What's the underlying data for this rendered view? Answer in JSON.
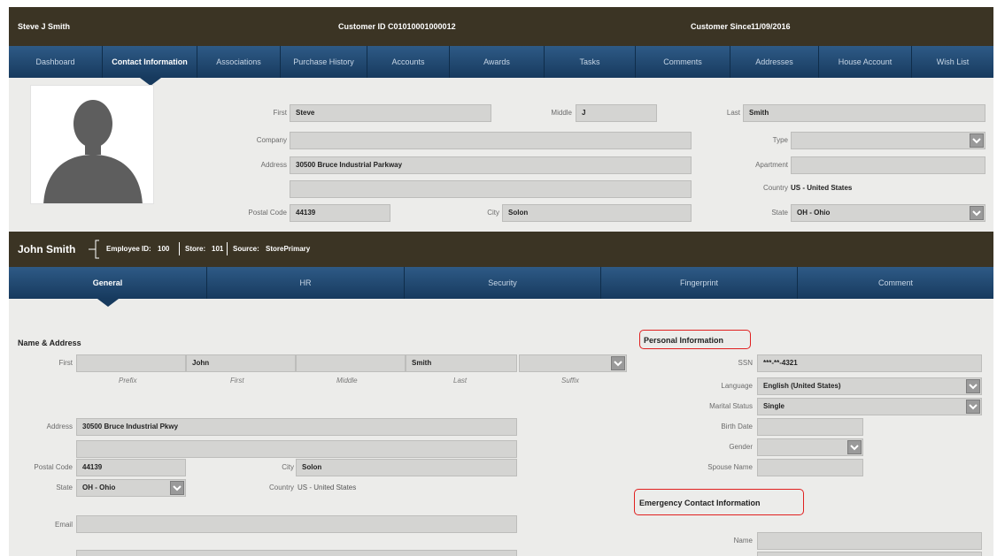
{
  "customer_header": {
    "name": "Steve J Smith",
    "customer_id_label": "Customer ID",
    "customer_id": "C01010001000012",
    "customer_since_label": "Customer Since",
    "customer_since": "11/09/2016"
  },
  "top_tabs": [
    "Dashboard",
    "Contact Information",
    "Associations",
    "Purchase History",
    "Accounts",
    "Awards",
    "Tasks",
    "Comments",
    "Addresses",
    "House Account",
    "Wish List"
  ],
  "contact": {
    "first_label": "First",
    "first_value": "Steve",
    "middle_label": "Middle",
    "middle_value": "J",
    "last_label": "Last",
    "last_value": "Smith",
    "company_label": "Company",
    "company_value": "",
    "type_label": "Type",
    "type_value": "",
    "address_label": "Address",
    "address_value": "30500 Bruce Industrial Parkway",
    "address2_value": "",
    "apartment_label": "Apartment",
    "apartment_value": "",
    "country_label": "Country",
    "country_value": "US - United States",
    "postal_label": "Postal Code",
    "postal_value": "44139",
    "city_label": "City",
    "city_value": "Solon",
    "state_label": "State",
    "state_value": "OH - Ohio"
  },
  "employee_header": {
    "name": "John Smith",
    "employee_id_label": "Employee ID:",
    "employee_id": "100",
    "store_label": "Store:",
    "store": "101",
    "source_label": "Source:",
    "source": "StorePrimary"
  },
  "sub_tabs": [
    "General",
    "HR",
    "Security",
    "Fingerprint",
    "Comment"
  ],
  "name_address": {
    "title": "Name & Address",
    "first_label": "First",
    "prefix_value": "",
    "first_value": "John",
    "middle_value": "",
    "last_value": "Smith",
    "suffix_value": "",
    "prefix_caption": "Prefix",
    "first_caption": "First",
    "middle_caption": "Middle",
    "last_caption": "Last",
    "suffix_caption": "Suffix",
    "address_label": "Address",
    "address_value": "30500 Bruce Industrial Pkwy",
    "address2_value": "",
    "postal_label": "Postal Code",
    "postal_value": "44139",
    "city_label": "City",
    "city_value": "Solon",
    "state_label": "State",
    "state_value": "OH - Ohio",
    "country_label": "Country",
    "country_value": "US - United States",
    "email_label": "Email",
    "email_value": ""
  },
  "personal": {
    "title": "Personal Information",
    "ssn_label": "SSN",
    "ssn_value": "***-**-4321",
    "language_label": "Language",
    "language_value": "English (United States)",
    "marital_label": "Marital Status",
    "marital_value": "Single",
    "birth_label": "Birth Date",
    "birth_value": "",
    "gender_label": "Gender",
    "gender_value": "",
    "spouse_label": "Spouse Name",
    "spouse_value": ""
  },
  "emergency": {
    "title": "Emergency Contact Information",
    "name_label": "Name",
    "name_value": ""
  },
  "colors": {
    "header_bg": "#3b3424",
    "nav_top": "#2e5a86",
    "nav_bottom": "#173a5e",
    "panel_bg": "#ececea",
    "field_bg": "#d4d4d2",
    "highlight": "#e02020"
  }
}
